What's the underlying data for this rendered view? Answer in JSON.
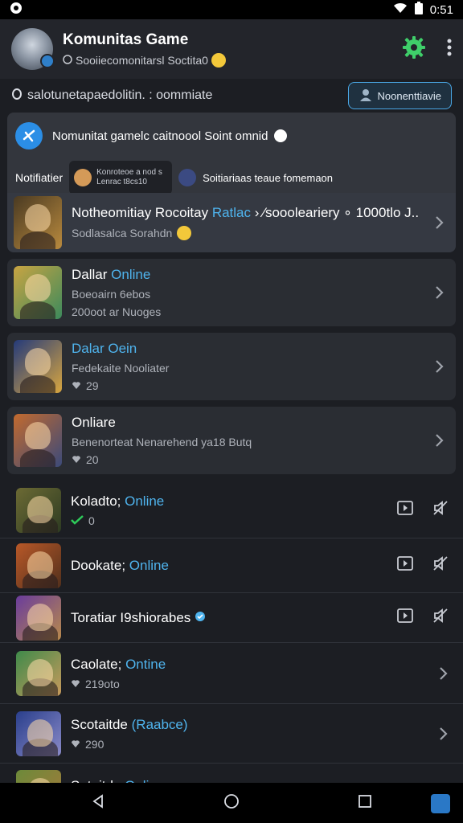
{
  "status": {
    "time": "0:51"
  },
  "header": {
    "title": "Komunitas Game",
    "subtitle": "Sooiiecomonitarsl Soctita0"
  },
  "search": {
    "text": "salotunetapaedolitin. : oommiate",
    "button_label": "Noonenttiavie"
  },
  "notification": {
    "message": "Nomunitat gamelc caitnoool Soint omnid",
    "label": "Notifiatier",
    "chip_line1": "Konroteoe a nod s",
    "chip_line2": "Lenrac t8cs10",
    "user_text": "Soitiariaas teaue fomemaon"
  },
  "cards": [
    {
      "title": "Notheomitiay Rocoitay",
      "title_accent": "Ratlac",
      "title_tail": " › ⁄soooleariery ∘ 1000tlo J..",
      "sub": "Sodlasalca Sorahdn",
      "colors": [
        "#4a3a22",
        "#b98a3e"
      ]
    },
    {
      "title": "Dallar",
      "title_accent": "Online",
      "sub": "Boeoairn 6ebos",
      "line2": "200oot ar Nuoges",
      "colors": [
        "#c8a442",
        "#3c8a5c"
      ]
    },
    {
      "title": "",
      "title_accent": "Dalar Oein",
      "sub": "Fedekaite Nooliater",
      "count": "29",
      "colors": [
        "#243a7a",
        "#d8a640"
      ]
    },
    {
      "title": "Onliare",
      "title_accent": "",
      "sub": "Benenorteat Nenarehend ya18 Butq",
      "count": "20",
      "colors": [
        "#c26a2e",
        "#3b4a7a"
      ]
    }
  ],
  "rows": [
    {
      "title": "Koladto;",
      "title_accent": "Online",
      "count": "0",
      "actions": true,
      "colors": [
        "#6c6a34",
        "#2d3b22"
      ]
    },
    {
      "title": "Dookate;",
      "title_accent": "Online",
      "actions": true,
      "colors": [
        "#b85828",
        "#52301c"
      ]
    },
    {
      "title": "Toratiar I9shiorabes",
      "title_accent": "",
      "actions": true,
      "colors": [
        "#6a3c9c",
        "#b88a4c"
      ]
    },
    {
      "title": "Caolate;",
      "title_accent": "Ontine",
      "count": "219oto",
      "actions": false,
      "colors": [
        "#3f8a4a",
        "#c89a5c"
      ]
    },
    {
      "title": "Scotaitde",
      "title_accent": "(Raabce)",
      "count": "290",
      "actions": false,
      "colors": [
        "#2a3f8c",
        "#8a8ac8"
      ]
    },
    {
      "title": "Sotaitde",
      "title_accent": "Online",
      "actions": false,
      "colors": [
        "#6c8a3a",
        "#a8783a"
      ]
    }
  ],
  "colors": {
    "accent": "#4fb4ee",
    "gear": "#3fcf6a",
    "online_check": "#2ecc5a"
  }
}
